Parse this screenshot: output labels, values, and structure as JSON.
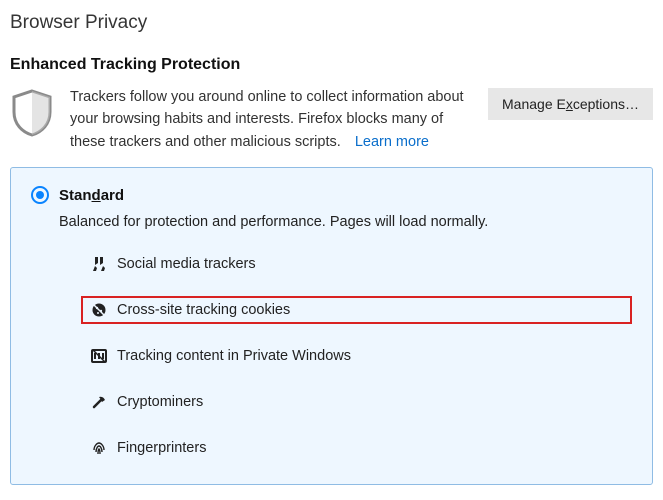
{
  "header": {
    "pageTitle": "Browser Privacy",
    "sectionTitle": "Enhanced Tracking Protection",
    "intro": "Trackers follow you around online to collect information about your browsing habits and interests. Firefox blocks many of these trackers and other malicious scripts.",
    "learnMore": "Learn more",
    "manageExceptions_pre": "Manage E",
    "manageExceptions_under": "x",
    "manageExceptions_post": "ceptions…"
  },
  "card": {
    "title_pre": "Stan",
    "title_under": "d",
    "title_post": "ard",
    "desc": "Balanced for protection and performance. Pages will load normally.",
    "items": [
      {
        "label": "Social media trackers",
        "icon": "thumbs",
        "highlight": false
      },
      {
        "label": "Cross-site tracking cookies",
        "icon": "cookie",
        "highlight": true
      },
      {
        "label": "Tracking content in Private Windows",
        "icon": "fence",
        "highlight": false
      },
      {
        "label": "Cryptominers",
        "icon": "pick",
        "highlight": false
      },
      {
        "label": "Fingerprinters",
        "icon": "fingerprint",
        "highlight": false
      }
    ]
  }
}
